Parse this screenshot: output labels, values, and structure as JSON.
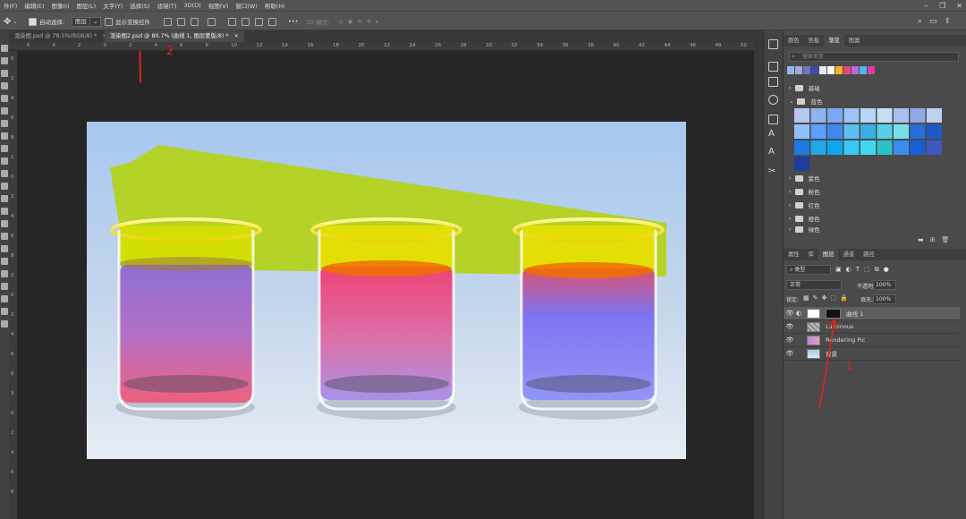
{
  "menubar": {
    "items": [
      "件(F)",
      "编辑(E)",
      "图像(I)",
      "图层(L)",
      "文字(Y)",
      "选择(S)",
      "滤镜(T)",
      "3D(D)",
      "视图(V)",
      "窗口(W)",
      "帮助(H)"
    ],
    "window_controls": [
      "‒",
      "❐",
      "✕"
    ]
  },
  "options": {
    "auto_select_label": "自动选择:",
    "auto_select_value": "图层",
    "show_transform_label": "显示变换控件",
    "mode_3d_label": "3D 模式:"
  },
  "tabs": [
    {
      "label": "渲染图.psd @ 78.5%(RGB/8) *",
      "close": "×"
    },
    {
      "label": "渲染图2.psd @ 80.7% (曲线 1, 图层蒙版/8) *",
      "close": "×"
    }
  ],
  "ruler_h_ticks": [
    "6",
    "4",
    "2",
    "0",
    "2",
    "4",
    "6",
    "8",
    "10",
    "12",
    "14",
    "16",
    "18",
    "20",
    "22",
    "24",
    "26",
    "28",
    "30",
    "32",
    "34",
    "36",
    "38",
    "40",
    "42",
    "44",
    "46",
    "48",
    "50",
    "52"
  ],
  "ruler_v_ticks": [
    "0",
    "2",
    "4",
    "6",
    "8",
    "1",
    "0",
    "2",
    "4",
    "6",
    "8",
    "2",
    "0",
    "2",
    "4",
    "6",
    "8",
    "3",
    "0",
    "2",
    "4",
    "6",
    "8"
  ],
  "annotations": {
    "marker_1": "1",
    "marker_2": "2"
  },
  "swatches_panel": {
    "tabs": [
      "颜色",
      "色板",
      "渐变",
      "图案"
    ],
    "active_tab": "渐变",
    "search_placeholder": "搜索渐变",
    "groups": [
      "基础",
      "蓝色",
      "紫色",
      "粉色",
      "红色",
      "橙色",
      "绿色"
    ]
  },
  "layers_panel": {
    "tabs": [
      "属性",
      "库",
      "图层",
      "通道",
      "路径"
    ],
    "active_tab": "图层",
    "filter_label": "类型",
    "blend_mode": "正常",
    "opacity_label": "不透明度:",
    "opacity_value": "100%",
    "lock_label": "锁定:",
    "fill_label": "填充:",
    "fill_value": "100%",
    "layers": [
      {
        "name": "曲线 1",
        "selected": true
      },
      {
        "name": "Luminous",
        "selected": false
      },
      {
        "name": "Rendering Pic",
        "selected": false
      },
      {
        "name": "背景",
        "selected": false
      }
    ]
  },
  "colors": {
    "accent_red": "#e0241c",
    "canvas_sky": "#a8c8ee",
    "green_overlay": "#b4d21e"
  }
}
